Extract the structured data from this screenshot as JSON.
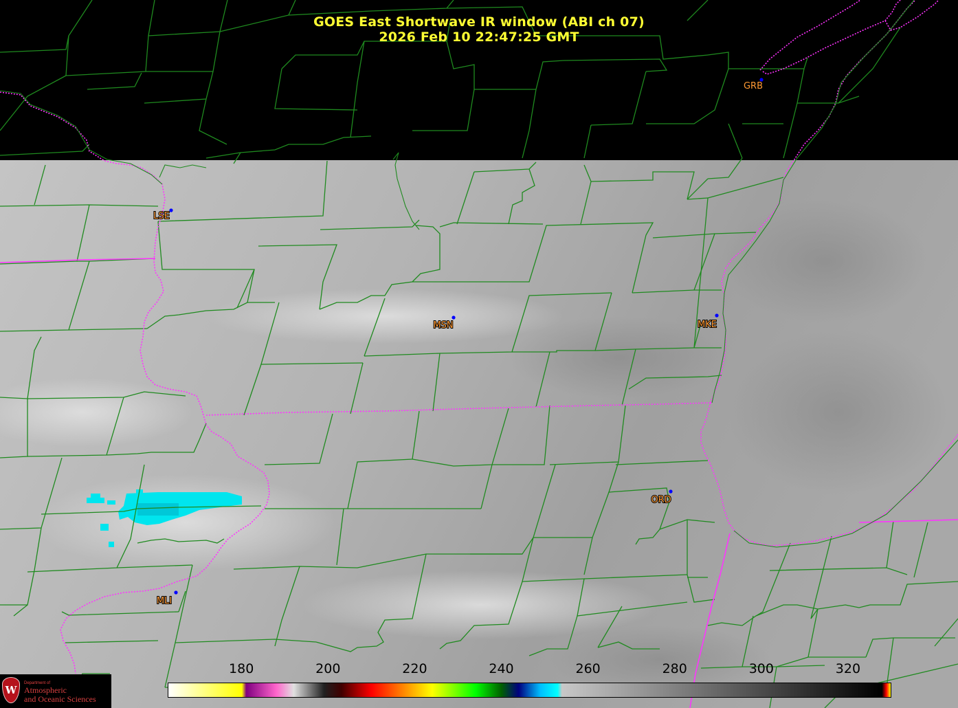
{
  "header": {
    "title": "GOES East Shortwave IR window (ABI ch 07)",
    "datetime": "2026 Feb 10  22:47:25 GMT"
  },
  "stations": [
    {
      "code": "GRB",
      "dot": [
        1108,
        116
      ],
      "label": [
        1096,
        129
      ]
    },
    {
      "code": "LSE",
      "dot": [
        249,
        306
      ],
      "label": [
        235,
        318
      ]
    },
    {
      "code": "MSN",
      "dot": [
        660,
        462
      ],
      "label": [
        645,
        477
      ]
    },
    {
      "code": "MKE",
      "dot": [
        1043,
        459
      ],
      "label": [
        1029,
        476
      ]
    },
    {
      "code": "ORD",
      "dot": [
        976,
        715
      ],
      "label": [
        962,
        731
      ]
    },
    {
      "code": "MLI",
      "dot": [
        256,
        862
      ],
      "label": [
        239,
        878
      ]
    }
  ],
  "colorbar": {
    "units_hidden": "K",
    "ticks": [
      "180",
      "200",
      "220",
      "240",
      "260",
      "280",
      "300",
      "320"
    ],
    "min": 163,
    "max": 330,
    "stops": [
      {
        "v": 163,
        "c": "#ffffff"
      },
      {
        "v": 180,
        "c": "#ffff00"
      },
      {
        "v": 181,
        "c": "#800080"
      },
      {
        "v": 188,
        "c": "#ff66cc"
      },
      {
        "v": 192,
        "c": "#e0e0e0"
      },
      {
        "v": 199,
        "c": "#202020"
      },
      {
        "v": 203,
        "c": "#400000"
      },
      {
        "v": 210,
        "c": "#ff0000"
      },
      {
        "v": 219,
        "c": "#ffa500"
      },
      {
        "v": 224,
        "c": "#ffff00"
      },
      {
        "v": 234,
        "c": "#00ff00"
      },
      {
        "v": 240,
        "c": "#006000"
      },
      {
        "v": 244,
        "c": "#000080"
      },
      {
        "v": 249,
        "c": "#00bfff"
      },
      {
        "v": 253,
        "c": "#00ffff"
      },
      {
        "v": 254,
        "c": "#c8c8c8"
      },
      {
        "v": 328,
        "c": "#000000"
      },
      {
        "v": 329,
        "c": "#ff0000"
      },
      {
        "v": 330,
        "c": "#ffff00"
      }
    ]
  },
  "logo": {
    "seal_letter": "W",
    "dept": "Department of",
    "line1": "Atmospheric",
    "line2": "and Oceanic Sciences"
  },
  "colors": {
    "title": "#ffff33",
    "county_lines": "#1f8a1f",
    "state_lines": "#ff33ff",
    "station_label": "#ff9933",
    "station_dot": "#0000ff",
    "cold_cloud": "#00e5ee"
  }
}
